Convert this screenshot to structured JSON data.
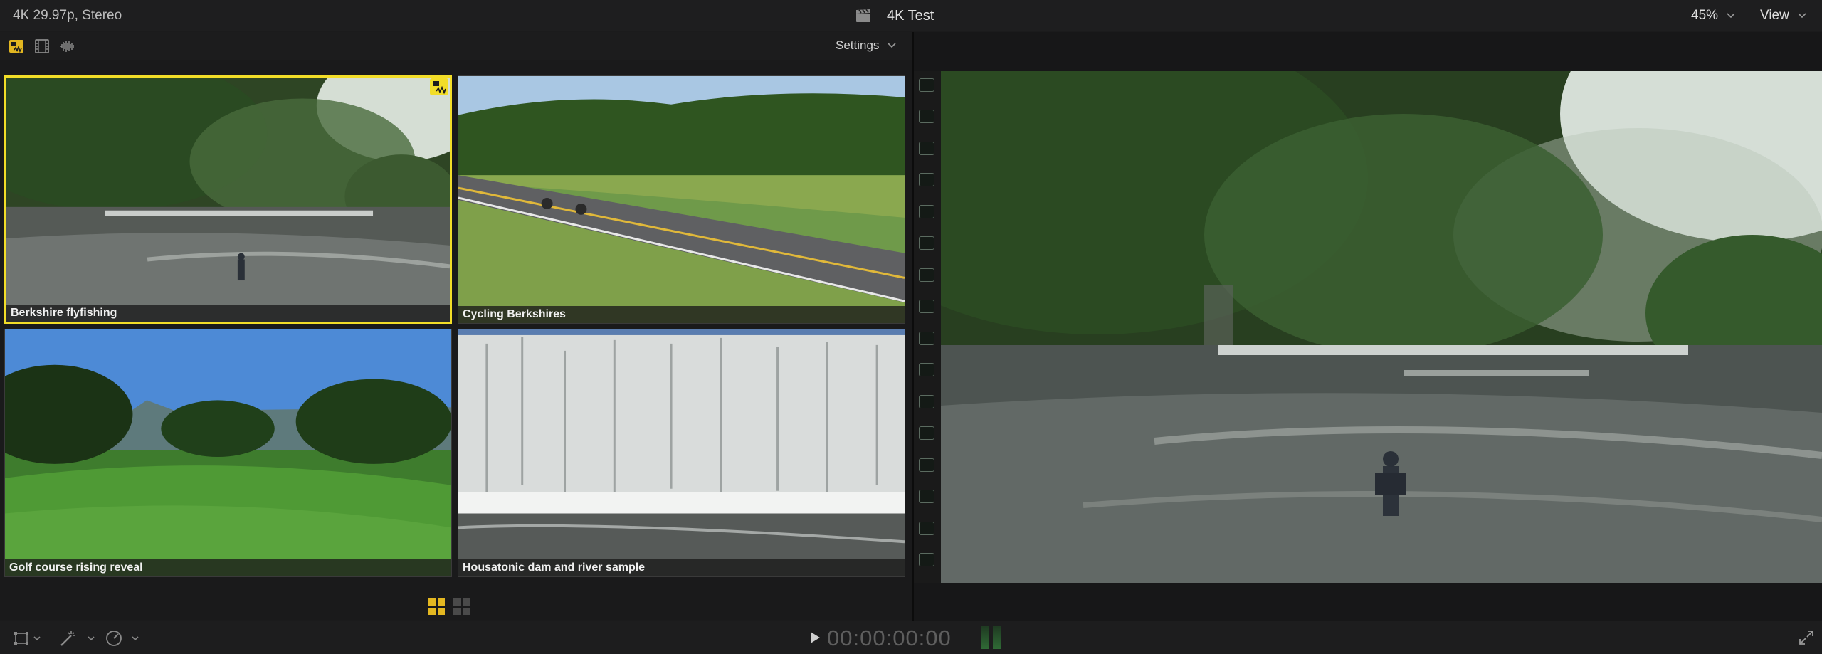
{
  "topbar": {
    "format": "4K 29.97p, Stereo",
    "title": "4K Test",
    "zoom": "45%",
    "view_label": "View"
  },
  "angle_viewer": {
    "settings_label": "Settings",
    "display_modes": [
      "video-audio-switch-icon",
      "video-only-icon",
      "audio-only-icon"
    ],
    "angles": [
      {
        "label": "Berkshire flyfishing",
        "active": true
      },
      {
        "label": "Cycling Berkshires",
        "active": false
      },
      {
        "label": "Golf course rising reveal",
        "active": false
      },
      {
        "label": "Housatonic dam and river sample",
        "active": false
      }
    ],
    "banks": [
      "bank-1",
      "bank-2"
    ],
    "accent": "#f2dd28"
  },
  "bottombar": {
    "timecode": "00:00:00:00"
  }
}
